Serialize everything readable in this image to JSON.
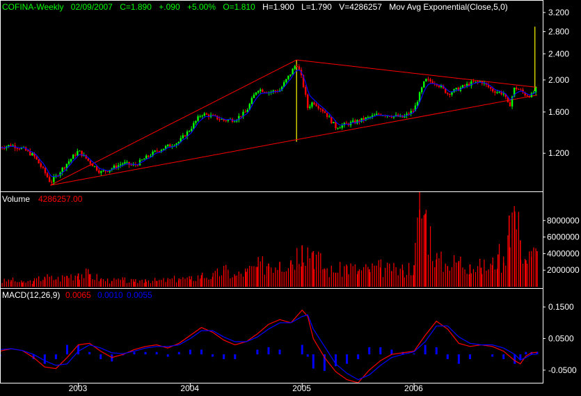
{
  "header": {
    "symbol": "COFINA-Weekly",
    "date": "02/09/2007",
    "close": "C=1.890",
    "change": "+.090",
    "pct": "+5.00%",
    "open": "O=1.810",
    "high": "H=1.900",
    "low": "L=1.790",
    "volume": "V=4286257",
    "indicator": "Mov Avg Exponential(Close,5,0)"
  },
  "volume_panel": {
    "label": "Volume",
    "value": "4286257.00"
  },
  "macd_panel": {
    "label": "MACD(12,26,9)",
    "macd": "0.0065",
    "signal": "0.0010",
    "hist": "0.0055"
  },
  "colors": {
    "up": "#00ff00",
    "down": "#ff0000",
    "ema": "#0000ff",
    "trend": "#ff0000",
    "volume": "#ff0000",
    "spike": "#ffff00",
    "border": "#ffffff",
    "axis": "#ffffff"
  },
  "chart_data": [
    {
      "type": "candlestick",
      "scale": "log",
      "ylim": [
        0.92,
        3.2
      ],
      "y_ticks": [
        "1.200",
        "1.600",
        "2.000",
        "2.400",
        "2.800",
        "3.200"
      ],
      "x_ticks": [
        "2003",
        "2004",
        "2005",
        "2006"
      ],
      "x": [
        2002.3,
        2002.4,
        2002.5,
        2002.6,
        2002.7,
        2002.75,
        2002.8,
        2002.9,
        2003.0,
        2003.1,
        2003.2,
        2003.3,
        2003.4,
        2003.5,
        2003.6,
        2003.7,
        2003.8,
        2003.9,
        2004.0,
        2004.1,
        2004.2,
        2004.3,
        2004.4,
        2004.5,
        2004.6,
        2004.7,
        2004.8,
        2004.9,
        2004.95,
        2005.0,
        2005.05,
        2005.1,
        2005.2,
        2005.3,
        2005.4,
        2005.5,
        2005.6,
        2005.7,
        2005.8,
        2005.9,
        2006.0,
        2006.1,
        2006.2,
        2006.3,
        2006.4,
        2006.5,
        2006.6,
        2006.7,
        2006.8,
        2006.85,
        2006.9,
        2006.95,
        2007.0,
        2007.05,
        2007.1
      ],
      "close": [
        1.25,
        1.27,
        1.24,
        1.18,
        1.05,
        0.98,
        1.02,
        1.12,
        1.22,
        1.13,
        1.05,
        1.08,
        1.12,
        1.1,
        1.16,
        1.22,
        1.26,
        1.3,
        1.42,
        1.58,
        1.55,
        1.51,
        1.52,
        1.6,
        1.88,
        1.84,
        1.86,
        2.1,
        2.25,
        2.0,
        1.65,
        1.72,
        1.6,
        1.44,
        1.47,
        1.5,
        1.54,
        1.58,
        1.56,
        1.54,
        1.62,
        2.0,
        1.96,
        1.82,
        1.88,
        1.95,
        1.98,
        1.86,
        1.82,
        1.65,
        1.9,
        1.86,
        1.8,
        1.8,
        1.89
      ],
      "trendlines": [
        {
          "from": [
            2002.75,
            0.96
          ],
          "to": [
            2004.95,
            2.3
          ]
        },
        {
          "from": [
            2004.95,
            2.3
          ],
          "to": [
            2007.1,
            1.9
          ]
        },
        {
          "from": [
            2002.75,
            0.96
          ],
          "to": [
            2007.1,
            1.8
          ]
        }
      ],
      "spikes": [
        {
          "x": 2004.95,
          "low": 1.3,
          "high": 2.3
        },
        {
          "x": 2007.08,
          "low": 1.85,
          "high": 2.9
        }
      ]
    },
    {
      "type": "bar",
      "name": "Volume",
      "ylim": [
        0,
        10000000
      ],
      "y_ticks": [
        "2000000",
        "4000000",
        "6000000",
        "8000000"
      ],
      "x": [
        2002.3,
        2002.4,
        2002.5,
        2002.6,
        2002.7,
        2002.8,
        2002.9,
        2003.0,
        2003.1,
        2003.2,
        2003.3,
        2003.4,
        2003.5,
        2003.6,
        2003.7,
        2003.8,
        2003.9,
        2004.0,
        2004.1,
        2004.2,
        2004.3,
        2004.4,
        2004.5,
        2004.6,
        2004.7,
        2004.8,
        2004.9,
        2005.0,
        2005.1,
        2005.2,
        2005.3,
        2005.4,
        2005.5,
        2005.6,
        2005.7,
        2005.8,
        2005.9,
        2006.0,
        2006.05,
        2006.1,
        2006.2,
        2006.3,
        2006.4,
        2006.5,
        2006.6,
        2006.7,
        2006.75,
        2006.8,
        2006.85,
        2006.9,
        2006.95,
        2007.0,
        2007.05,
        2007.1
      ],
      "values": [
        600000,
        800000,
        500000,
        700000,
        1200000,
        900000,
        1300000,
        1600000,
        1500000,
        900000,
        700000,
        800000,
        600000,
        900000,
        700000,
        800000,
        1000000,
        900000,
        1400000,
        1200000,
        2000000,
        1300000,
        1800000,
        2400000,
        2800000,
        3000000,
        3200000,
        5000000,
        4300000,
        2200000,
        1700000,
        2500000,
        1900000,
        2100000,
        2300000,
        1900000,
        2000000,
        2600000,
        9300000,
        8800000,
        3300000,
        2500000,
        3100000,
        2700000,
        2300000,
        2600000,
        3900000,
        2900000,
        8600000,
        9100000,
        5600000,
        3200000,
        3600000,
        4286257
      ]
    },
    {
      "type": "line",
      "name": "MACD(12,26,9)",
      "ylim": [
        -0.09,
        0.17
      ],
      "y_ticks": [
        "-0.0500",
        "0.0500",
        "0.1500"
      ],
      "x": [
        2002.3,
        2002.4,
        2002.5,
        2002.6,
        2002.7,
        2002.8,
        2002.9,
        2003.0,
        2003.1,
        2003.2,
        2003.3,
        2003.4,
        2003.5,
        2003.6,
        2003.7,
        2003.8,
        2003.9,
        2004.0,
        2004.1,
        2004.2,
        2004.3,
        2004.4,
        2004.5,
        2004.6,
        2004.7,
        2004.8,
        2004.9,
        2005.0,
        2005.05,
        2005.1,
        2005.2,
        2005.3,
        2005.4,
        2005.5,
        2005.6,
        2005.7,
        2005.8,
        2005.9,
        2006.0,
        2006.1,
        2006.2,
        2006.3,
        2006.4,
        2006.5,
        2006.6,
        2006.7,
        2006.8,
        2006.9,
        2006.95,
        2007.0,
        2007.05,
        2007.1
      ],
      "series": [
        {
          "name": "MACD",
          "color": "#ff0000",
          "values": [
            0.01,
            0.018,
            0.012,
            -0.01,
            -0.04,
            -0.045,
            -0.01,
            0.03,
            0.035,
            0.01,
            -0.01,
            0.0,
            0.015,
            0.025,
            0.03,
            0.02,
            0.035,
            0.06,
            0.085,
            0.07,
            0.045,
            0.03,
            0.04,
            0.065,
            0.095,
            0.11,
            0.1,
            0.14,
            0.12,
            0.05,
            -0.01,
            -0.055,
            -0.08,
            -0.09,
            -0.05,
            -0.02,
            0.0,
            0.005,
            0.01,
            0.06,
            0.105,
            0.08,
            0.035,
            0.025,
            0.03,
            0.025,
            0.01,
            -0.02,
            -0.03,
            -0.005,
            0.005,
            0.0065
          ]
        },
        {
          "name": "Signal",
          "color": "#0000ff",
          "values": [
            0.015,
            0.018,
            0.012,
            0.0,
            -0.02,
            -0.035,
            -0.03,
            0.01,
            0.03,
            0.02,
            0.005,
            0.002,
            0.01,
            0.02,
            0.025,
            0.025,
            0.03,
            0.05,
            0.075,
            0.075,
            0.055,
            0.04,
            0.04,
            0.055,
            0.08,
            0.1,
            0.1,
            0.12,
            0.125,
            0.08,
            0.025,
            -0.03,
            -0.06,
            -0.08,
            -0.065,
            -0.035,
            -0.01,
            0.0,
            0.008,
            0.04,
            0.09,
            0.09,
            0.055,
            0.035,
            0.03,
            0.03,
            0.02,
            0.0,
            -0.018,
            -0.01,
            0.0,
            0.001
          ]
        }
      ],
      "histogram": {
        "name": "Histogram",
        "color": "#0000ff"
      }
    }
  ]
}
